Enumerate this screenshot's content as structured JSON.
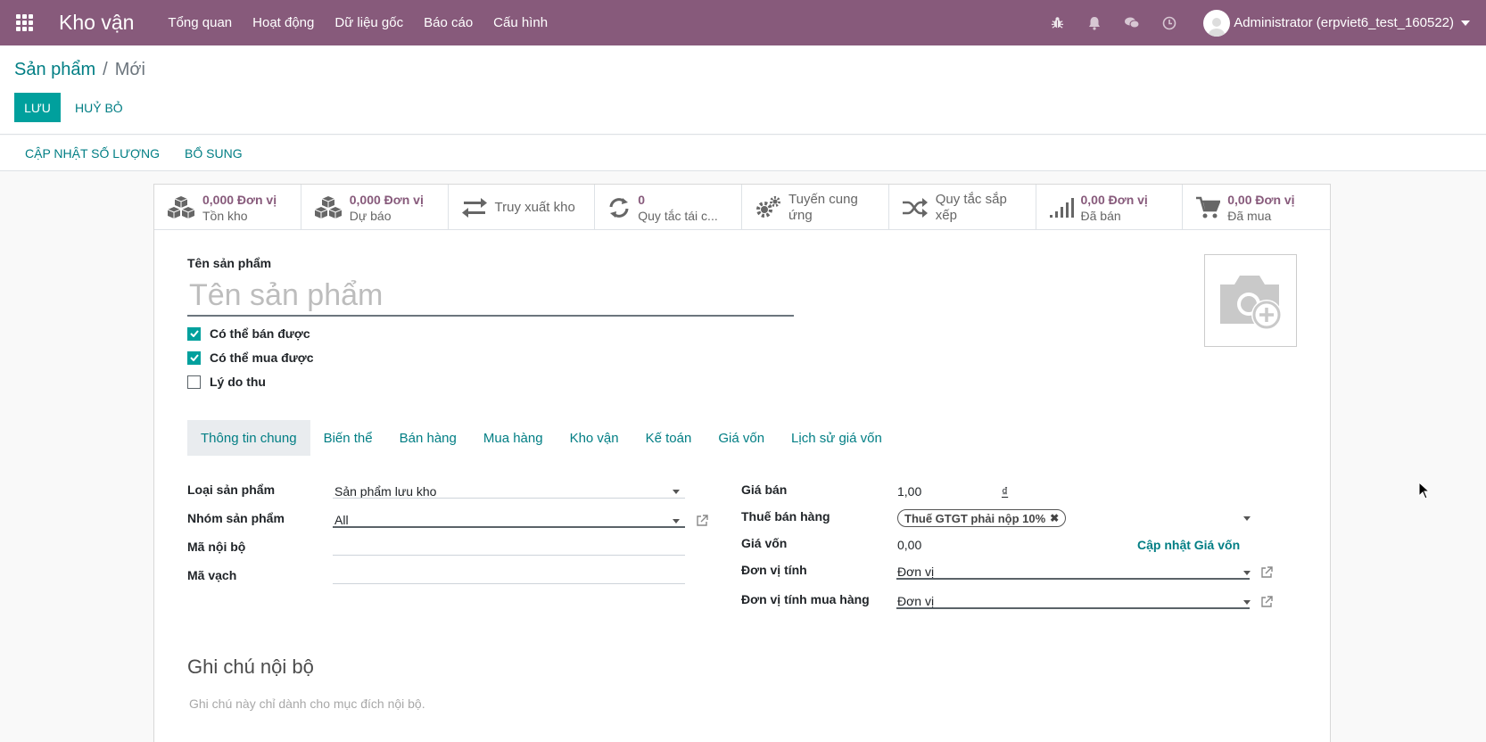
{
  "navbar": {
    "app_title": "Kho vận",
    "menu": [
      "Tổng quan",
      "Hoạt động",
      "Dữ liệu gốc",
      "Báo cáo",
      "Cấu hình"
    ],
    "system_icons": [
      "bug-icon",
      "bell-icon",
      "chat-icon",
      "clock-icon"
    ],
    "user_name": "Administrator (erpviet6_test_160522)",
    "colors": {
      "bar": "#875a7b",
      "text": "#ffffff"
    }
  },
  "breadcrumb": {
    "parent": "Sản phẩm",
    "separator": "/",
    "current": "Mới"
  },
  "actions": {
    "save": "LƯU",
    "discard": "HUỶ BỎ"
  },
  "statusbar": {
    "update_qty": "CẬP NHẬT SỐ LƯỢNG",
    "replenish": "BỔ SUNG"
  },
  "smart_buttons": [
    {
      "icon": "cubes-icon",
      "value": "0,000 Đơn vị",
      "label": "Tồn kho"
    },
    {
      "icon": "cubes-icon",
      "value": "0,000 Đơn vị",
      "label": "Dự báo"
    },
    {
      "icon": "exchange-icon",
      "value": "",
      "label": "Truy xuất kho"
    },
    {
      "icon": "refresh-icon",
      "value": "0",
      "label": "Quy tắc tái c..."
    },
    {
      "icon": "cogs-icon",
      "value": "",
      "label": "Tuyến cung ứng"
    },
    {
      "icon": "random-icon",
      "value": "",
      "label": "Quy tắc sắp xếp"
    },
    {
      "icon": "signal-icon",
      "value": "0,00 Đơn vị",
      "label": "Đã bán"
    },
    {
      "icon": "cart-icon",
      "value": "0,00 Đơn vị",
      "label": "Đã mua"
    }
  ],
  "product": {
    "name_label": "Tên sản phẩm",
    "name_placeholder": "Tên sản phẩm",
    "checkboxes": [
      {
        "label": "Có thể bán được",
        "checked": true
      },
      {
        "label": "Có thể mua được",
        "checked": true
      },
      {
        "label": "Lý do thu",
        "checked": false
      }
    ]
  },
  "tabs": [
    "Thông tin chung",
    "Biến thể",
    "Bán hàng",
    "Mua hàng",
    "Kho vận",
    "Kế toán",
    "Giá vốn",
    "Lịch sử giá vốn"
  ],
  "active_tab": "Thông tin chung",
  "general": {
    "left": {
      "type_label": "Loại sản phẩm",
      "type_value": "Sản phẩm lưu kho",
      "categ_label": "Nhóm sản phẩm",
      "categ_value": "All",
      "ref_label": "Mã nội bộ",
      "ref_value": "",
      "barcode_label": "Mã vạch",
      "barcode_value": ""
    },
    "right": {
      "price_label": "Giá bán",
      "price_value": "1,00",
      "currency": "₫",
      "tax_label": "Thuế bán hàng",
      "tax_tag": "Thuế GTGT phải nộp 10%",
      "cost_label": "Giá vốn",
      "cost_value": "0,00",
      "cost_update": "Cập nhật Giá vốn",
      "uom_label": "Đơn vị tính",
      "uom_value": "Đơn vị",
      "uom_po_label": "Đơn vị tính mua hàng",
      "uom_po_value": "Đơn vị"
    }
  },
  "notes": {
    "title": "Ghi chú nội bộ",
    "placeholder": "Ghi chú này chỉ dành cho mục đích nội bộ."
  },
  "colors": {
    "primary": "#00a09d",
    "link": "#017e84",
    "brand": "#875a7b"
  }
}
